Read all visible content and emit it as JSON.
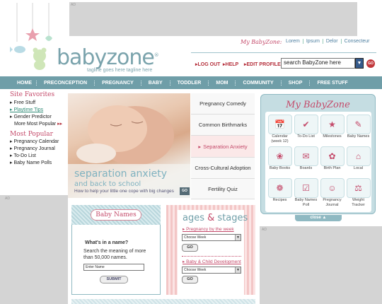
{
  "ad_label": "AD",
  "header": {
    "logo_text": "babyzone",
    "logo_reg": "®",
    "tagline": "tagline goes here tagline here",
    "my_babyzone": "My BabyZone:",
    "top_links": [
      "Lorem",
      "Ipsum",
      "Delor",
      "Consecteur"
    ],
    "log_out": "LOG OUT",
    "help": "HELP",
    "edit_profile": "EDIT PROFILE",
    "search_placeholder": "search BabyZone here",
    "search_go": "GO"
  },
  "nav": [
    "HOME",
    "PRECONCEPTION",
    "PREGNANCY",
    "BABY",
    "TODDLER",
    "MOM",
    "COMMUNITY",
    "SHOP",
    "FREE STUFF"
  ],
  "sidebar": {
    "favorites_title": "Site Favorites",
    "favorites": [
      {
        "label": "Free Stuff"
      },
      {
        "label": "Playtime Tips"
      },
      {
        "label": "Gender Predictor"
      },
      {
        "label": "More Most Popular"
      }
    ],
    "popular_title": "Most Popular",
    "popular": [
      "Pregnancy Calendar",
      "Pregnancy Journal",
      "To-Do List",
      "Baby Name Polls"
    ]
  },
  "hero": {
    "title": "separation anxiety",
    "subtitle": "and back to school",
    "caption": "How to help your little one cope with big changes",
    "go": "GO"
  },
  "features": [
    "Pregnancy Comedy",
    "Common Birthmarks",
    "Separation Anxiety",
    "Cross-Cultural Adoption",
    "Fertility Quiz"
  ],
  "baby_names": {
    "title": "Baby Names",
    "question": "What's in a name?",
    "description": "Search the meaning of more than 50,000 names.",
    "input_placeholder": "Enter Name",
    "submit": "SUBMIT"
  },
  "ages_stages": {
    "title_a": "ages",
    "title_amp": "&",
    "title_b": "stages",
    "link1": "Pregnancy by the week",
    "select1": "Choose Week",
    "go1": "GO",
    "link2": "Baby & Child Development",
    "select2": "Choose Week",
    "go2": "GO"
  },
  "my_babyzone_panel": {
    "title": "My BabyZone",
    "tiles": [
      {
        "label": "Calendar (week 12)",
        "icon": "calendar-icon"
      },
      {
        "label": "To-Do List",
        "icon": "todo-icon"
      },
      {
        "label": "Milestones",
        "icon": "milestones-icon"
      },
      {
        "label": "Baby Names",
        "icon": "babynames-icon"
      },
      {
        "label": "Baby Books",
        "icon": "books-icon"
      },
      {
        "label": "Boards",
        "icon": "boards-icon"
      },
      {
        "label": "Birth Plan",
        "icon": "birthplan-icon"
      },
      {
        "label": "Local",
        "icon": "local-icon"
      },
      {
        "label": "Recipes",
        "icon": "recipes-icon"
      },
      {
        "label": "Baby Names Poll",
        "icon": "poll-icon"
      },
      {
        "label": "Pregnancy Journal",
        "icon": "journal-icon"
      },
      {
        "label": "Weight Tracker",
        "icon": "weight-icon"
      }
    ],
    "close": "close ▲"
  },
  "colors": {
    "nav": "#6f9ea8",
    "pink": "#c44a6a",
    "red": "#b42e3a",
    "teal": "#7aa3ac"
  }
}
